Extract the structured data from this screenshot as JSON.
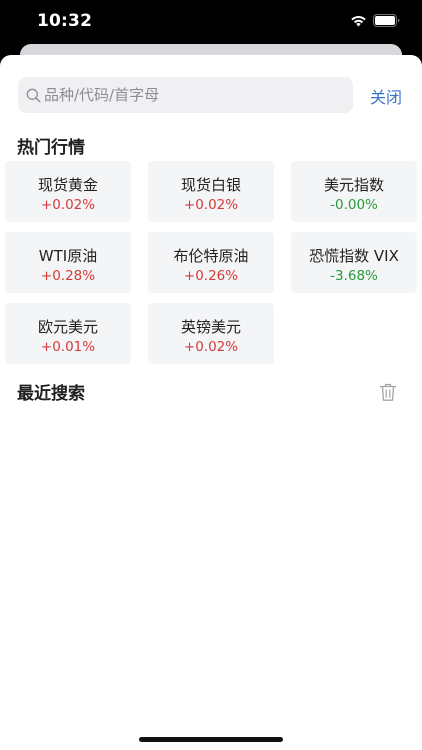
{
  "status_bar": {
    "time": "10:32",
    "icons": [
      "wifi-icon",
      "battery-icon"
    ]
  },
  "search": {
    "placeholder": "品种/代码/首字母",
    "value": "",
    "icon": "search-icon"
  },
  "close_label": "关闭",
  "hot_section": {
    "title": "热门行情",
    "items": [
      {
        "name": "现货黄金",
        "change": "+0.02%",
        "trend": "up"
      },
      {
        "name": "现货白银",
        "change": "+0.02%",
        "trend": "up"
      },
      {
        "name": "美元指数",
        "change": "-0.00%",
        "trend": "down"
      },
      {
        "name": "WTI原油",
        "change": "+0.28%",
        "trend": "up"
      },
      {
        "name": "布伦特原油",
        "change": "+0.26%",
        "trend": "up"
      },
      {
        "name": "恐慌指数 VIX",
        "change": "-3.68%",
        "trend": "down"
      },
      {
        "name": "欧元美元",
        "change": "+0.01%",
        "trend": "up"
      },
      {
        "name": "英镑美元",
        "change": "+0.02%",
        "trend": "up"
      }
    ]
  },
  "recent_section": {
    "title": "最近搜索",
    "clear_icon": "trash-icon"
  },
  "colors": {
    "accent": "#3a73c9",
    "up": "#d63b3b",
    "down": "#2a9a3b",
    "card_bg": "#f4f5f7",
    "search_bg": "#f0f0f3"
  }
}
